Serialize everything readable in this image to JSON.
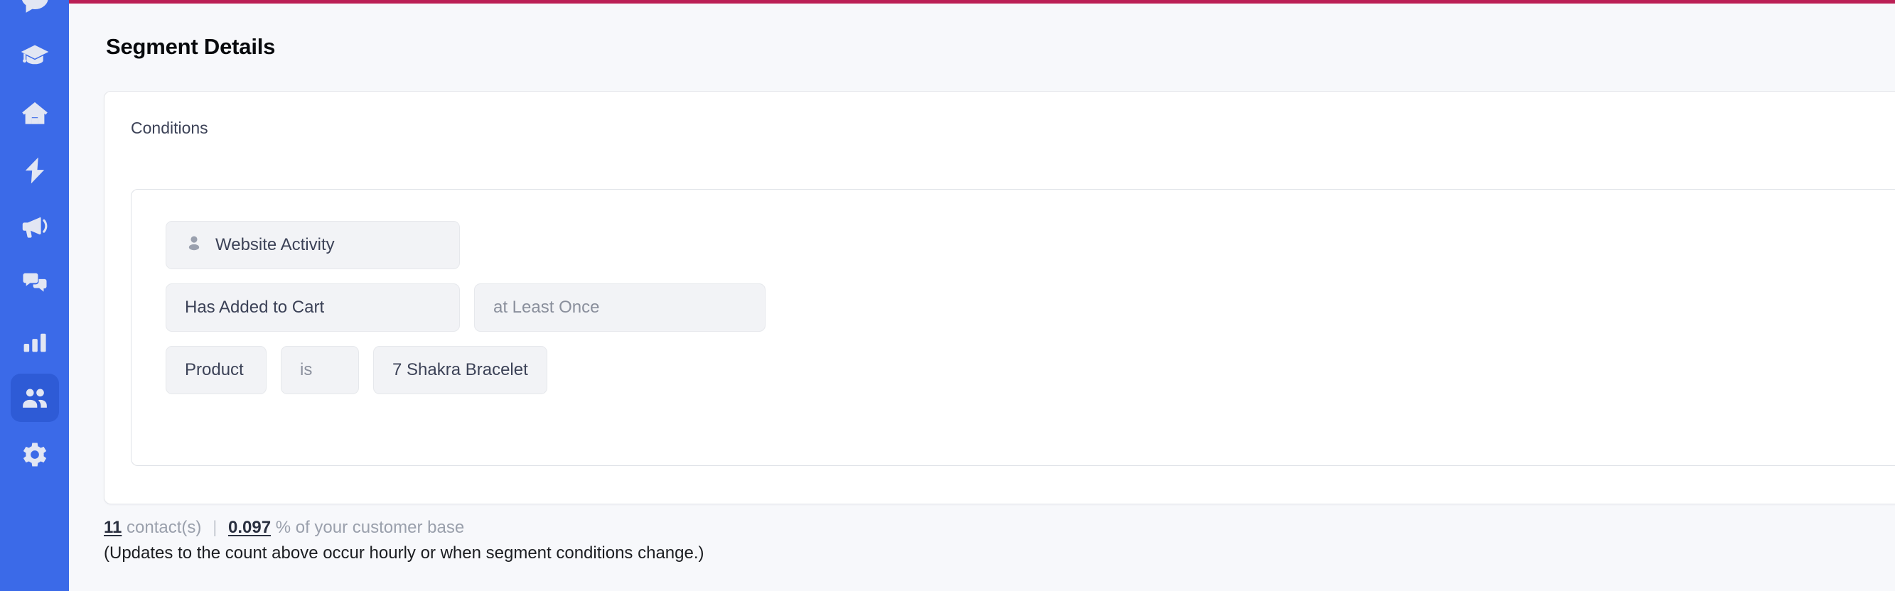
{
  "theme": {
    "sidebar_bg": "#3b6ae8",
    "sidebar_active_bg": "#2e5bd6",
    "accent_rule": "#bb1f55",
    "page_bg": "#f7f8fb",
    "chip_bg": "#f2f3f6",
    "text_primary": "#3c4257",
    "text_muted": "#8a8f9c"
  },
  "sidebar": {
    "items": [
      {
        "icon": "chat-bubble-icon",
        "active": false
      },
      {
        "icon": "graduation-cap-icon",
        "active": false
      },
      {
        "icon": "home-icon",
        "active": false
      },
      {
        "icon": "lightning-bolt-icon",
        "active": false
      },
      {
        "icon": "megaphone-icon",
        "active": false
      },
      {
        "icon": "conversations-icon",
        "active": false
      },
      {
        "icon": "bar-chart-icon",
        "active": false
      },
      {
        "icon": "contacts-people-icon",
        "active": true
      },
      {
        "icon": "gear-icon",
        "active": false
      }
    ]
  },
  "page": {
    "title": "Segment Details"
  },
  "card": {
    "label": "Conditions",
    "conditions": [
      {
        "type": "attribute",
        "icon": "person-icon",
        "chips": [
          {
            "label": "Website Activity",
            "muted": false,
            "size": "attr",
            "icon": "person-icon"
          }
        ]
      },
      {
        "type": "event",
        "chips": [
          {
            "label": "Has Added to Cart",
            "muted": false,
            "size": "verb"
          },
          {
            "label": "at Least Once",
            "muted": true,
            "size": "freq"
          }
        ]
      },
      {
        "type": "filter",
        "chips": [
          {
            "label": "Product",
            "muted": false,
            "size": "field"
          },
          {
            "label": "is",
            "muted": true,
            "size": "op"
          },
          {
            "label": "7 Shakra Bracelet",
            "muted": false,
            "size": "attr"
          }
        ]
      }
    ]
  },
  "footer": {
    "count": "11",
    "count_suffix": "contact(s)",
    "separator": "|",
    "percent": "0.097",
    "percent_suffix": "% of your customer base",
    "note": "(Updates to the count above occur hourly or when segment conditions change.)"
  }
}
